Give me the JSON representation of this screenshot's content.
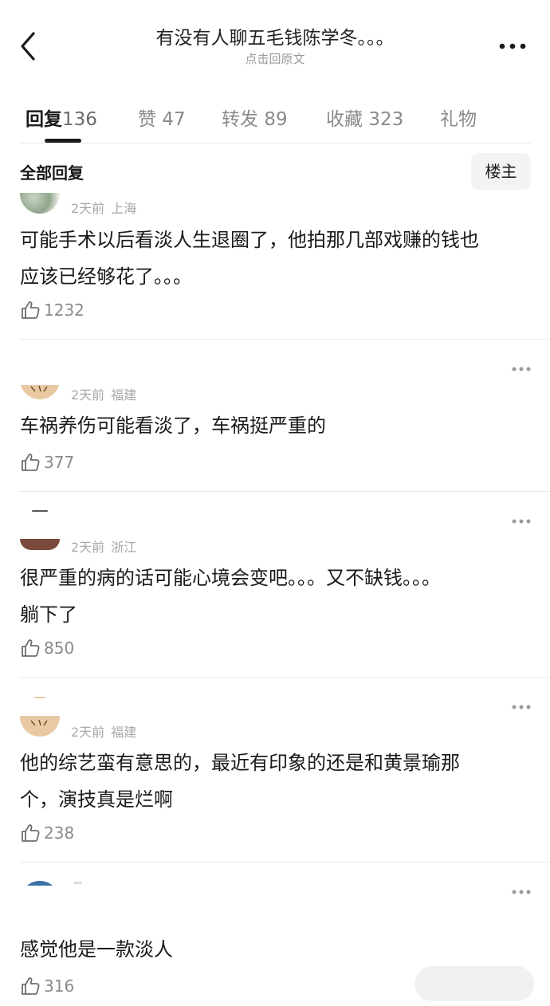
{
  "header": {
    "title": "有没有人聊五毛钱陈学冬。。。",
    "subtitle": "点击回原文"
  },
  "tabs": [
    {
      "label": "回复",
      "count": "136"
    },
    {
      "label": "赞",
      "count": "47"
    },
    {
      "label": "转发",
      "count": "89"
    },
    {
      "label": "收藏",
      "count": "323"
    },
    {
      "label": "礼物",
      "count": ""
    }
  ],
  "section": {
    "title": "全部回复",
    "owner_button": "楼主"
  },
  "comments": [
    {
      "time": "2天前",
      "location": "上海",
      "lines": [
        "可能手术以后看淡人生退圈了，他拍那几部戏赚的钱也",
        "应该已经够花了。。。"
      ],
      "likes": "1232"
    },
    {
      "time": "2天前",
      "location": "福建",
      "lines": [
        "车祸养伤可能看淡了，车祸挺严重的"
      ],
      "likes": "377"
    },
    {
      "time": "2天前",
      "location": "浙江",
      "lines": [
        "很严重的病的话可能心境会变吧。。。又不缺钱。。。",
        "躺下了"
      ],
      "likes": "850"
    },
    {
      "time": "2天前",
      "location": "福建",
      "lines": [
        "他的综艺蛮有意思的，最近有印象的还是和黄景瑜那",
        "个，演技真是烂啊"
      ],
      "likes": "238"
    },
    {
      "time": "",
      "location": "",
      "lines": [
        "感觉他是一款淡人"
      ],
      "likes": "316"
    }
  ],
  "icons": {
    "back": "chevron-left-icon",
    "more": "ellipsis-icon",
    "like": "thumbs-up-icon"
  }
}
